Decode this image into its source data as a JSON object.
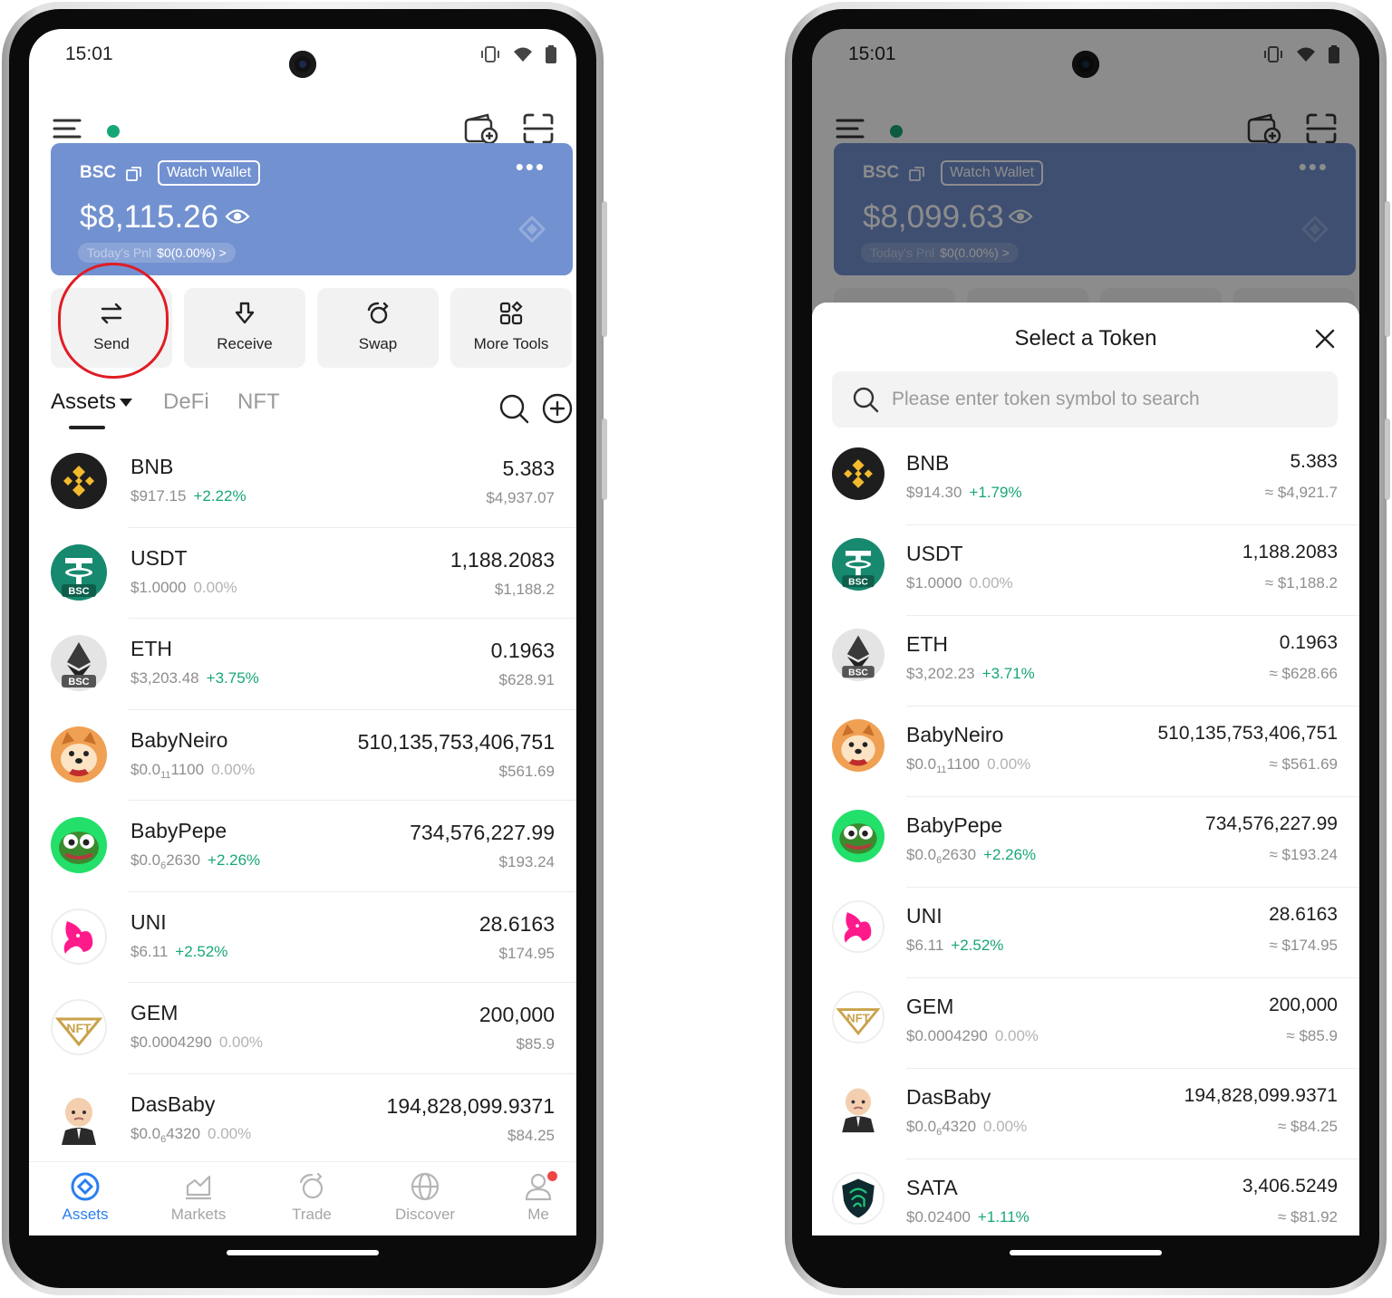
{
  "status_bar": {
    "time": "15:01"
  },
  "left": {
    "wallet": {
      "chain": "BSC",
      "watch_label": "Watch Wallet",
      "balance": "$8,115.26",
      "pnl_label": "Today's Pnl",
      "pnl_value": "$0(0.00%) >"
    },
    "actions": [
      {
        "label": "Send",
        "icon": "send-icon"
      },
      {
        "label": "Receive",
        "icon": "receive-icon"
      },
      {
        "label": "Swap",
        "icon": "swap-icon"
      },
      {
        "label": "More Tools",
        "icon": "more-tools-icon"
      }
    ],
    "tabs": [
      "Assets",
      "DeFi",
      "NFT"
    ],
    "tokens": [
      {
        "symbol": "BNB",
        "price": "$917.15",
        "change": "+2.22%",
        "trend": "up",
        "amount": "5.383",
        "value": "$4,937.07"
      },
      {
        "symbol": "USDT",
        "price": "$1.0000",
        "change": "0.00%",
        "trend": "flat",
        "amount": "1,188.2083",
        "value": "$1,188.2"
      },
      {
        "symbol": "ETH",
        "price": "$3,203.48",
        "change": "+3.75%",
        "trend": "up",
        "amount": "0.1963",
        "value": "$628.91"
      },
      {
        "symbol": "BabyNeiro",
        "price_prefix": "$0.0",
        "price_sub": "11",
        "price_suffix": "1100",
        "change": "0.00%",
        "trend": "flat",
        "amount": "510,135,753,406,751",
        "value": "$561.69"
      },
      {
        "symbol": "BabyPepe",
        "price_prefix": "$0.0",
        "price_sub": "6",
        "price_suffix": "2630",
        "change": "+2.26%",
        "trend": "up",
        "amount": "734,576,227.99",
        "value": "$193.24"
      },
      {
        "symbol": "UNI",
        "price": "$6.11",
        "change": "+2.52%",
        "trend": "up",
        "amount": "28.6163",
        "value": "$174.95"
      },
      {
        "symbol": "GEM",
        "price": "$0.0004290",
        "change": "0.00%",
        "trend": "flat",
        "amount": "200,000",
        "value": "$85.9"
      },
      {
        "symbol": "DasBaby",
        "price_prefix": "$0.0",
        "price_sub": "6",
        "price_suffix": "4320",
        "change": "0.00%",
        "trend": "flat",
        "amount": "194,828,099.9371",
        "value": "$84.25"
      }
    ],
    "bottom_nav": [
      "Assets",
      "Markets",
      "Trade",
      "Discover",
      "Me"
    ]
  },
  "right": {
    "wallet": {
      "chain": "BSC",
      "watch_label": "Watch Wallet",
      "balance": "$8,099.63",
      "pnl_label": "Today's Pnl",
      "pnl_value": "$0(0.00%) >"
    },
    "sheet": {
      "title": "Select a Token",
      "search_placeholder": "Please enter token symbol to search"
    },
    "tokens": [
      {
        "symbol": "BNB",
        "price": "$914.30",
        "change": "+1.79%",
        "trend": "up",
        "amount": "5.383",
        "value": "≈ $4,921.7"
      },
      {
        "symbol": "USDT",
        "price": "$1.0000",
        "change": "0.00%",
        "trend": "flat",
        "amount": "1,188.2083",
        "value": "≈ $1,188.2"
      },
      {
        "symbol": "ETH",
        "price": "$3,202.23",
        "change": "+3.71%",
        "trend": "up",
        "amount": "0.1963",
        "value": "≈ $628.66"
      },
      {
        "symbol": "BabyNeiro",
        "price_prefix": "$0.0",
        "price_sub": "11",
        "price_suffix": "1100",
        "change": "0.00%",
        "trend": "flat",
        "amount": "510,135,753,406,751",
        "value": "≈ $561.69"
      },
      {
        "symbol": "BabyPepe",
        "price_prefix": "$0.0",
        "price_sub": "6",
        "price_suffix": "2630",
        "change": "+2.26%",
        "trend": "up",
        "amount": "734,576,227.99",
        "value": "≈ $193.24"
      },
      {
        "symbol": "UNI",
        "price": "$6.11",
        "change": "+2.52%",
        "trend": "up",
        "amount": "28.6163",
        "value": "≈ $174.95"
      },
      {
        "symbol": "GEM",
        "price": "$0.0004290",
        "change": "0.00%",
        "trend": "flat",
        "amount": "200,000",
        "value": "≈ $85.9"
      },
      {
        "symbol": "DasBaby",
        "price_prefix": "$0.0",
        "price_sub": "6",
        "price_suffix": "4320",
        "change": "0.00%",
        "trend": "flat",
        "amount": "194,828,099.9371",
        "value": "≈ $84.25"
      },
      {
        "symbol": "SATA",
        "price": "$0.02400",
        "change": "+1.11%",
        "trend": "up",
        "amount": "3,406.5249",
        "value": "≈ $81.92"
      }
    ]
  },
  "colors": {
    "accent": "#2a7ff0",
    "up": "#17a776",
    "card": "#7291d0",
    "highlight": "#e01c24"
  }
}
